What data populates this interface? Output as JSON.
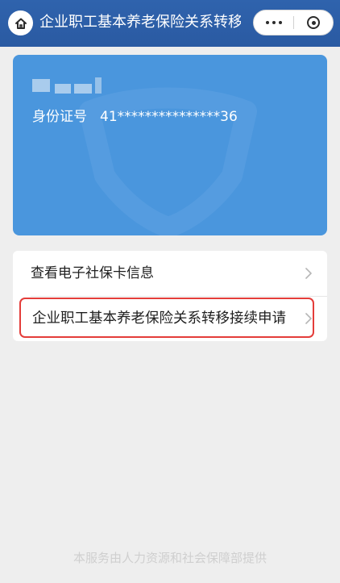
{
  "header": {
    "title": "企业职工基本养老保险关系转移...",
    "home_icon": "home-icon",
    "more_icon": "more-dots-icon",
    "close_icon": "target-close-icon"
  },
  "card": {
    "name_display": "█ ▆ ▆ 㐬",
    "id_label": "身份证号",
    "id_value": "41***************36",
    "color": "#4a96dd"
  },
  "menu": {
    "items": [
      {
        "label": "查看电子社保卡信息",
        "icon": "chevron-right-icon"
      },
      {
        "label": "企业职工基本养老保险关系转移接续申请",
        "icon": "chevron-right-icon"
      }
    ]
  },
  "footer": {
    "text": "本服务由人力资源和社会保障部提供"
  },
  "colors": {
    "header": "#2e5fa9",
    "highlight": "#e43d3a",
    "background": "#eeeeee"
  }
}
